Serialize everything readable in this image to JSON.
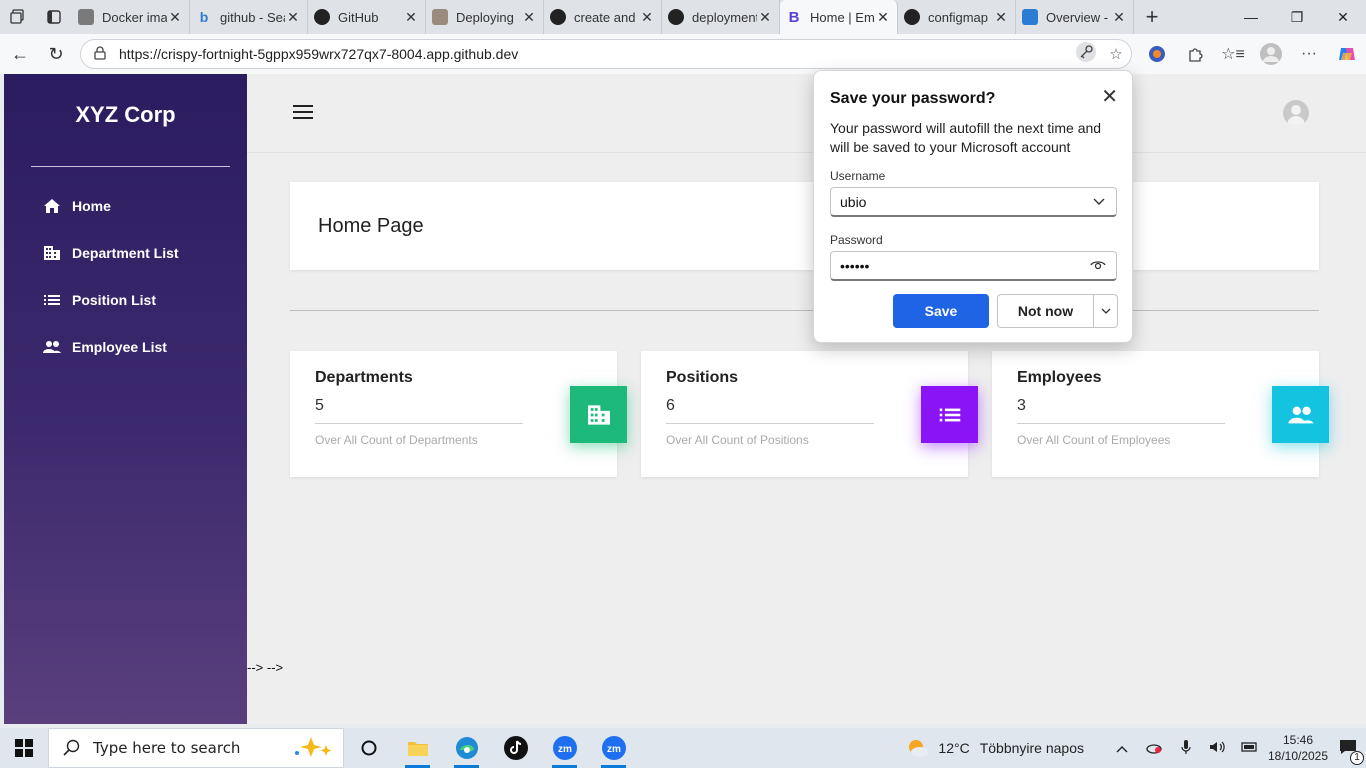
{
  "browser": {
    "tabs": [
      {
        "title": "Docker image",
        "icon": "gear-icon",
        "color": "#7a7a7a"
      },
      {
        "title": "github - Search",
        "icon": "bing-icon",
        "color": "#2f7cd6"
      },
      {
        "title": "GitHub",
        "icon": "github-icon",
        "color": "#222222"
      },
      {
        "title": "Deploying",
        "icon": "image-icon",
        "color": "#9b8b7e"
      },
      {
        "title": "create and",
        "icon": "github-icon",
        "color": "#222222"
      },
      {
        "title": "deployment",
        "icon": "github-icon",
        "color": "#222222"
      },
      {
        "title": "Home | Employee",
        "icon": "bootstrap-icon",
        "color": "#5b3fd6",
        "active": true
      },
      {
        "title": "configmap",
        "icon": "github-icon",
        "color": "#222222"
      },
      {
        "title": "Overview -",
        "icon": "azure-cloud-icon",
        "color": "#2b7cd3"
      }
    ],
    "url": "https://crispy-fortnight-5gppx959wrx727qx7-8004.app.github.dev"
  },
  "app": {
    "brand": "XYZ Corp",
    "nav": [
      {
        "label": "Home",
        "icon": "home-icon"
      },
      {
        "label": "Department List",
        "icon": "building-icon"
      },
      {
        "label": "Position List",
        "icon": "list-icon"
      },
      {
        "label": "Employee List",
        "icon": "people-icon"
      }
    ],
    "page_title": "Home Page",
    "stats": [
      {
        "title": "Departments",
        "value": "5",
        "desc": "Over All Count of Departments",
        "icon": "building-icon",
        "color": "#1db97a"
      },
      {
        "title": "Positions",
        "value": "6",
        "desc": "Over All Count of Positions",
        "icon": "list-icon",
        "color": "#8a14f5"
      },
      {
        "title": "Employees",
        "value": "3",
        "desc": "Over All Count of Employees",
        "icon": "people-icon",
        "color": "#14c3e0"
      }
    ],
    "debris": "--> -->"
  },
  "password_popup": {
    "title": "Save your password?",
    "desc": "Your password will autofill the next time and will be saved to your Microsoft account",
    "username_label": "Username",
    "username": "ubio",
    "password_label": "Password",
    "password_mask": "••••••",
    "save": "Save",
    "not_now": "Not now"
  },
  "taskbar": {
    "search_placeholder": "Type here to search",
    "weather_temp": "12°C",
    "weather_desc": "Többnyire napos",
    "time": "15:46",
    "date": "18/10/2025",
    "notification_count": "1"
  }
}
